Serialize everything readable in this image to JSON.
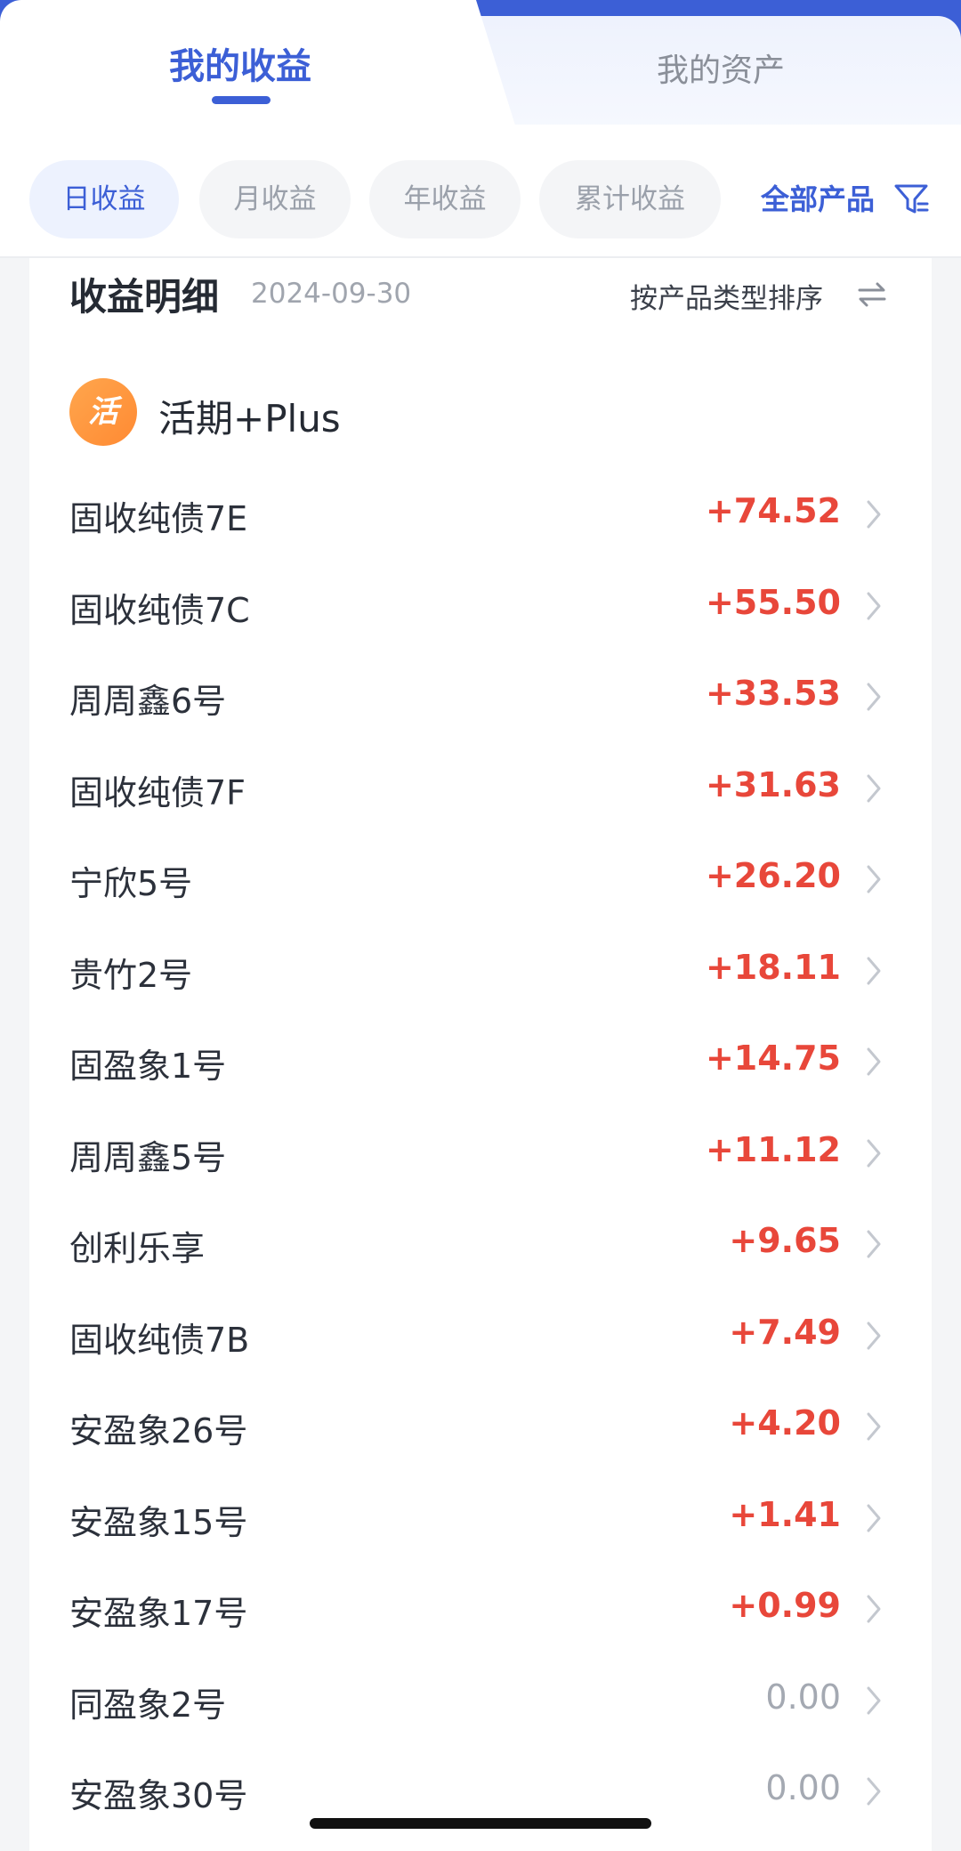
{
  "header": {
    "tab_active": "我的收益",
    "tab_inactive": "我的资产"
  },
  "chips": {
    "items": [
      "日收益",
      "月收益",
      "年收益",
      "累计收益"
    ],
    "active_index": 0,
    "filter_label": "全部产品"
  },
  "section": {
    "title": "收益明细",
    "date": "2024-09-30",
    "sort_label": "按产品类型排序"
  },
  "product_group": {
    "logo_text": "活",
    "name": "活期+Plus"
  },
  "rows": [
    {
      "name": "固收纯债7E",
      "value": "+74.52"
    },
    {
      "name": "固收纯债7C",
      "value": "+55.50"
    },
    {
      "name": "周周鑫6号",
      "value": "+33.53"
    },
    {
      "name": "固收纯债7F",
      "value": "+31.63"
    },
    {
      "name": "宁欣5号",
      "value": "+26.20"
    },
    {
      "name": "贵竹2号",
      "value": "+18.11"
    },
    {
      "name": "固盈象1号",
      "value": "+14.75"
    },
    {
      "name": "周周鑫5号",
      "value": "+11.12"
    },
    {
      "name": "创利乐享",
      "value": "+9.65"
    },
    {
      "name": "固收纯债7B",
      "value": "+7.49"
    },
    {
      "name": "安盈象26号",
      "value": "+4.20"
    },
    {
      "name": "安盈象15号",
      "value": "+1.41"
    },
    {
      "name": "安盈象17号",
      "value": "+0.99"
    },
    {
      "name": "同盈象2号",
      "value": "0.00"
    },
    {
      "name": "安盈象30号",
      "value": "0.00"
    }
  ],
  "colors": {
    "accent": "#3c5fd6",
    "positive": "#e8473a",
    "zero": "#a4a9b2",
    "logo": "#ff8a33"
  }
}
